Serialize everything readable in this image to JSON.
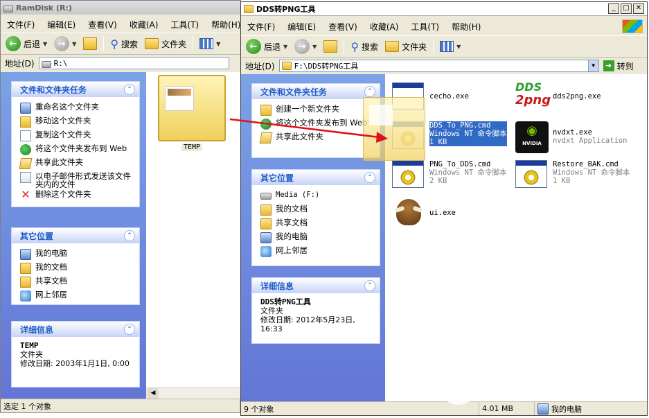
{
  "left": {
    "title": "RamDisk (R:)",
    "menu": [
      "文件(F)",
      "编辑(E)",
      "查看(V)",
      "收藏(A)",
      "工具(T)",
      "帮助(H)"
    ],
    "toolbar": {
      "back": "后退",
      "search": "搜索",
      "folders": "文件夹"
    },
    "address_label": "地址(D)",
    "address_value": "R:\\",
    "tasks_title": "文件和文件夹任务",
    "tasks": [
      "重命名这个文件夹",
      "移动这个文件夹",
      "复制这个文件夹",
      "将这个文件夹发布到 Web",
      "共享此文件夹",
      "以电子邮件形式发送该文件夹内的文件",
      "删除这个文件夹"
    ],
    "other_title": "其它位置",
    "other": [
      "我的电脑",
      "我的文档",
      "共享文档",
      "网上邻居"
    ],
    "detail_title": "详细信息",
    "detail_name": "TEMP",
    "detail_type": "文件夹",
    "detail_modified": "修改日期: 2003年1月1日, 0:00",
    "folder_label": "TEMP",
    "status": "选定 1 个对象"
  },
  "right": {
    "title": "DDS转PNG工具",
    "menu": [
      "文件(F)",
      "编辑(E)",
      "查看(V)",
      "收藏(A)",
      "工具(T)",
      "帮助(H)"
    ],
    "toolbar": {
      "back": "后退",
      "search": "搜索",
      "folders": "文件夹"
    },
    "address_label": "地址(D)",
    "address_value": "F:\\DDS转PNG工具",
    "go": "转到",
    "tasks_title": "文件和文件夹任务",
    "tasks": [
      "创建一个新文件夹",
      "将这个文件夹发布到 Web",
      "共享此文件夹"
    ],
    "other_title": "其它位置",
    "other": [
      "Media (F:)",
      "我的文档",
      "共享文档",
      "我的电脑",
      "网上邻居"
    ],
    "detail_title": "详细信息",
    "detail_name": "DDS转PNG工具",
    "detail_type": "文件夹",
    "detail_modified": "修改日期: 2012年5月23日, 16:33",
    "files": [
      {
        "name": "cecho.exe",
        "sub1": "",
        "sub2": ""
      },
      {
        "name": "dds2png.exe",
        "sub1": "",
        "sub2": ""
      },
      {
        "name": "DDS_To_PNG.cmd",
        "sub1": "Windows NT 命令脚本",
        "sub2": "1 KB"
      },
      {
        "name": "nvdxt.exe",
        "sub1": "nvdxt Application",
        "sub2": ""
      },
      {
        "name": "PNG_To_DDS.cmd",
        "sub1": "Windows NT 命令脚本",
        "sub2": "2 KB"
      },
      {
        "name": "Restore_BAK.cmd",
        "sub1": "Windows NT 命令脚本",
        "sub2": "1 KB"
      },
      {
        "name": "ui.exe",
        "sub1": "",
        "sub2": ""
      }
    ],
    "status_count": "9 个对象",
    "status_size": "4.01 MB",
    "status_loc": "我的电脑"
  },
  "logo_text": {
    "dds": "DDS",
    "png": "2png",
    "nvidia": "NVIDIA"
  },
  "colors": {
    "taskpane": "#6375d6",
    "panel_head": "#215dc6",
    "selection": "#316ac5",
    "arrow": "#e0101a"
  }
}
